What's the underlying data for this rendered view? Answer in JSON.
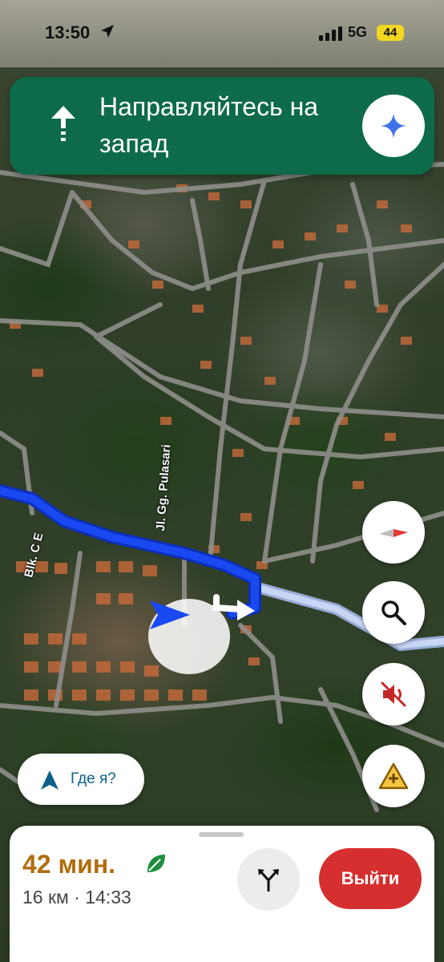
{
  "status_bar": {
    "time": "13:50",
    "network": "5G",
    "battery": "44"
  },
  "direction_banner": {
    "instruction": "Направляйтесь на запад",
    "direction_icon": "arrow-up-icon",
    "assistant_icon": "sparkle-icon"
  },
  "map": {
    "road_labels": [
      "Jl. Gg. Pulasari",
      "Blk. C E"
    ]
  },
  "map_controls": {
    "compass_icon": "compass-icon",
    "search_icon": "search-icon",
    "mute_icon": "volume-off-icon",
    "report_icon": "report-incident-icon"
  },
  "where_button": {
    "label": "Где я?",
    "icon": "navigation-arrow-icon"
  },
  "trip_panel": {
    "eta": "42 мин.",
    "eco_icon": "leaf-icon",
    "distance_arrival": "16 км · 14:33",
    "routes_icon": "alternate-routes-icon",
    "exit_label": "Выйти"
  },
  "colors": {
    "banner": "#0e6b4a",
    "route": "#1a49f2",
    "eta": "#b06d0e",
    "exit": "#d62f2f"
  }
}
